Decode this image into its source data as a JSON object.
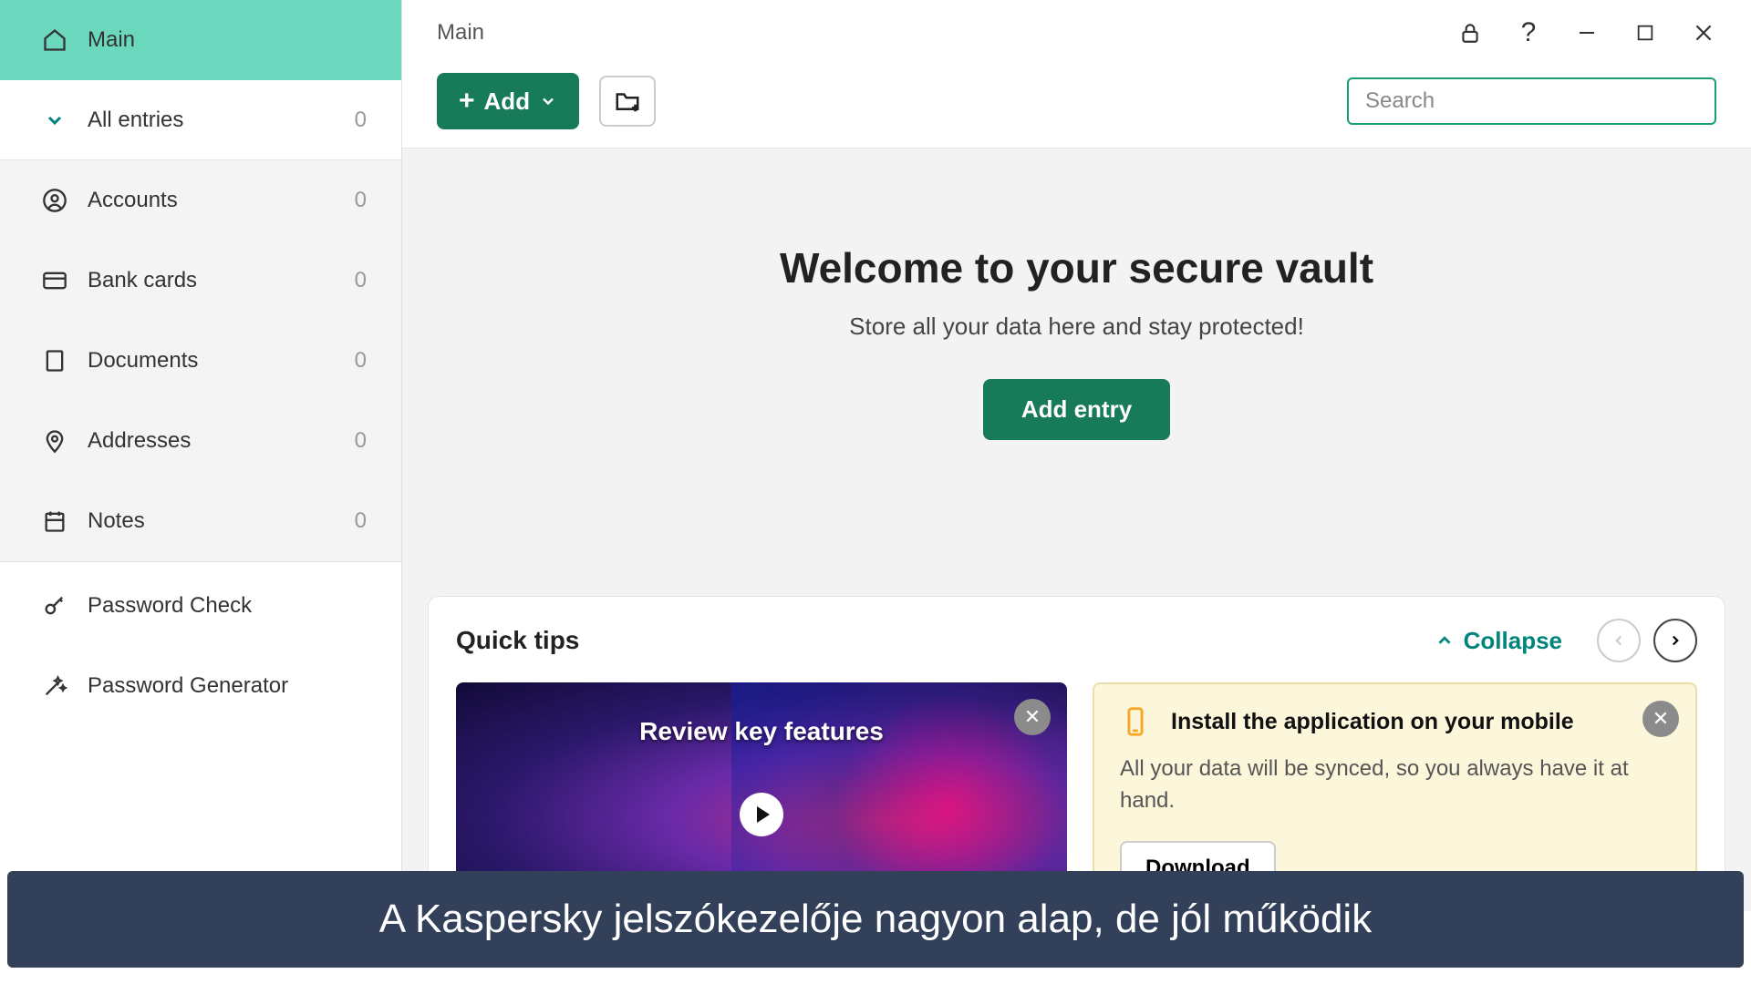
{
  "sidebar": {
    "main_label": "Main",
    "all_entries": {
      "label": "All entries",
      "count": "0"
    },
    "categories": [
      {
        "label": "Accounts",
        "count": "0",
        "icon": "account"
      },
      {
        "label": "Bank cards",
        "count": "0",
        "icon": "card"
      },
      {
        "label": "Documents",
        "count": "0",
        "icon": "document"
      },
      {
        "label": "Addresses",
        "count": "0",
        "icon": "pin"
      },
      {
        "label": "Notes",
        "count": "0",
        "icon": "note"
      }
    ],
    "tools": [
      {
        "label": "Password Check",
        "icon": "key"
      },
      {
        "label": "Password Generator",
        "icon": "wand"
      }
    ]
  },
  "header": {
    "title": "Main"
  },
  "toolbar": {
    "add_label": "Add"
  },
  "search": {
    "placeholder": "Search"
  },
  "welcome": {
    "heading": "Welcome to your secure vault",
    "subtext": "Store all your data here and stay protected!",
    "cta": "Add entry"
  },
  "tips": {
    "title": "Quick tips",
    "collapse_label": "Collapse",
    "video_title": "Review key features",
    "install_title": "Install the application on your mobile",
    "install_body": "All your data will be synced, so you always have it at hand.",
    "download_label": "Download"
  },
  "caption": "A Kaspersky jelszókezelője nagyon alap, de jól működik"
}
